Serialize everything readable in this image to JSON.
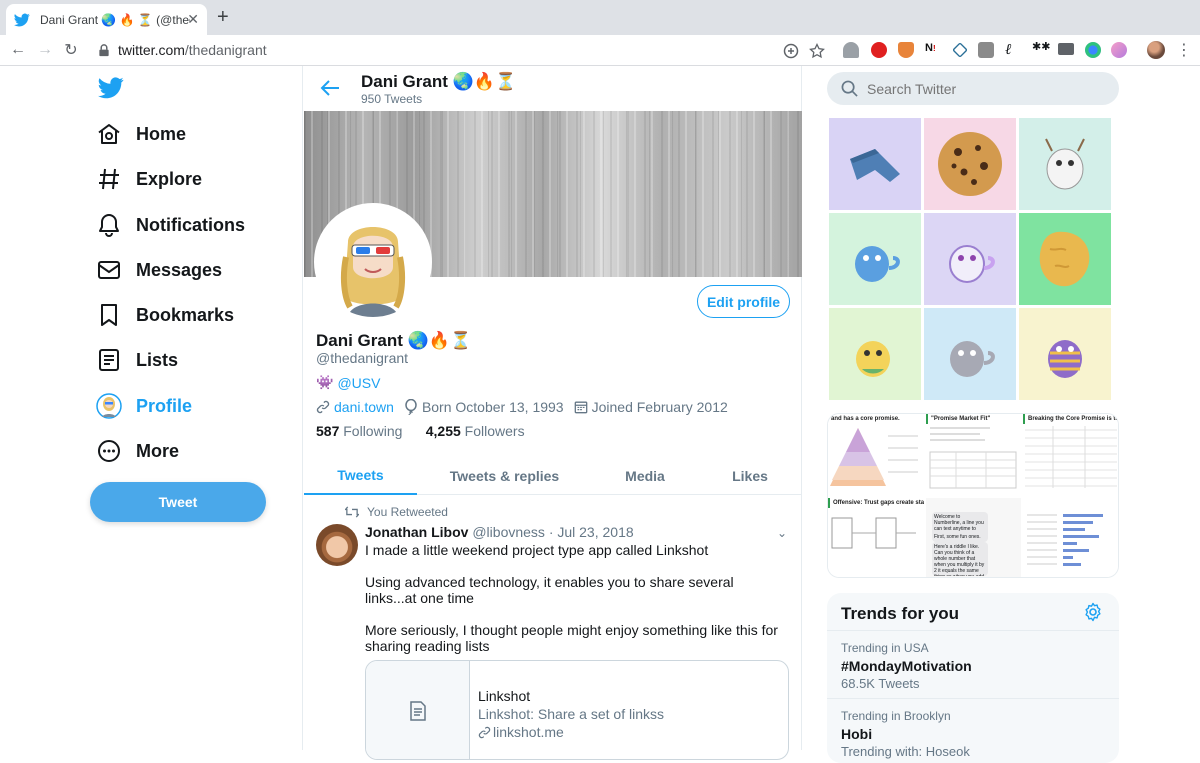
{
  "browser": {
    "tab_title": "Dani Grant 🌏 🔥 ⏳ (@thedanigrant)",
    "url_domain": "twitter.com",
    "url_path": "/thedanigrant"
  },
  "nav": {
    "items": [
      {
        "label": "Home"
      },
      {
        "label": "Explore"
      },
      {
        "label": "Notifications"
      },
      {
        "label": "Messages"
      },
      {
        "label": "Bookmarks"
      },
      {
        "label": "Lists"
      },
      {
        "label": "Profile"
      },
      {
        "label": "More"
      }
    ],
    "tweet_button": "Tweet"
  },
  "header": {
    "name": "Dani Grant 🌏🔥⏳",
    "tweet_count": "950 Tweets"
  },
  "profile": {
    "name": "Dani Grant 🌏🔥⏳",
    "handle": "@thedanigrant",
    "bio_emoji": "👾",
    "bio_link": "@USV",
    "website": "dani.town",
    "born": "Born October 13, 1993",
    "joined": "Joined February 2012",
    "following_count": "587",
    "following_label": "Following",
    "followers_count": "4,255",
    "followers_label": "Followers",
    "edit_button": "Edit profile",
    "tabs": [
      {
        "label": "Tweets"
      },
      {
        "label": "Tweets & replies"
      },
      {
        "label": "Media"
      },
      {
        "label": "Likes"
      }
    ]
  },
  "tweet": {
    "retweet_context": "You Retweeted",
    "author": "Jonathan Libov",
    "handle": "@libovness",
    "date": "· Jul 23, 2018",
    "paragraphs": [
      "I made a little weekend project type app called Linkshot",
      "Using advanced technology, it enables you to share several links...at one time",
      "More seriously, I thought people might enjoy something like this for sharing reading lists"
    ],
    "card": {
      "title": "Linkshot",
      "description": "Linkshot: Share a set of linkss",
      "link": "linkshot.me"
    }
  },
  "sidebar": {
    "search_placeholder": "Search Twitter",
    "media_grid": [
      {
        "name": "jeans",
        "bg": "#d9d3f5"
      },
      {
        "name": "cookie",
        "bg": "#f7d8e6"
      },
      {
        "name": "white-kitty",
        "bg": "#d3efe9"
      },
      {
        "name": "blue-kitty",
        "bg": "#d4f3dd"
      },
      {
        "name": "purple-kitty",
        "bg": "#dcd6f5"
      },
      {
        "name": "chip",
        "bg": "#7fe3a0"
      },
      {
        "name": "yellow-kitty",
        "bg": "#e1f5d3"
      },
      {
        "name": "grey-kitty",
        "bg": "#cfe9f7"
      },
      {
        "name": "pattern-kitty",
        "bg": "#f8f3cf"
      }
    ],
    "slides": {
      "slide1_title": "and has a core promise.",
      "slide2_title": "\"Promise Market Fit\"",
      "slide3_title": "Breaking the Core Promise is the",
      "slide4_title": "Offensive: Trust gaps create start",
      "chat_lines": [
        "Welcome to Numberline, a line you can text anytime to play with numbers 😊",
        "First, some fun ones.",
        "Here's a riddle I like. Can you think of a whole number that when you multiply it by 2 it equals the same thing as when you add 2 to it?"
      ]
    },
    "trends": {
      "title": "Trends for you",
      "items": [
        {
          "context": "Trending in USA",
          "topic": "#MondayMotivation",
          "sub": "68.5K Tweets"
        },
        {
          "context": "Trending in Brooklyn",
          "topic": "Hobi",
          "sub": "Trending with: Hoseok"
        }
      ]
    }
  },
  "colors": {
    "accent": "#1da1f2",
    "tweet_button": "#4aa8ea",
    "text_secondary": "#657786"
  }
}
